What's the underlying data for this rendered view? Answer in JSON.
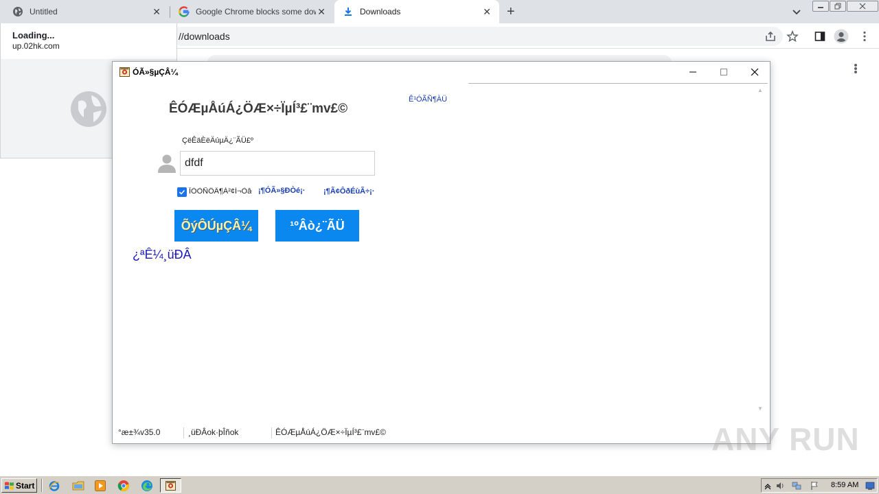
{
  "browser": {
    "tabs": [
      {
        "title": "Untitled",
        "icon": "globe-icon"
      },
      {
        "title": "Google Chrome blocks some downloads",
        "icon": "google-icon"
      },
      {
        "title": "Downloads",
        "icon": "download-icon"
      }
    ],
    "new_tab_label": "+",
    "address": "//downloads"
  },
  "loading_popup": {
    "title": "Loading...",
    "url": "up.02hk.com"
  },
  "app": {
    "window_title": "ÓÃ»§µÇÂ¼",
    "heading": "ÊÓÆµÅúÁ¿ÖÆ×÷ÏµÍ³£¨mv£©",
    "top_link": "Ê¹ÓÃÑ¶ÀÜ",
    "field_label": "ÇëÊäÈëÄúµÄ¿¨ÃÜ£º",
    "username_value": "dfdf",
    "remember_label": "ÎÒÒÑÔÄ¶Á²¢Í¬ÒâÓÃ»§Ð­Òé",
    "link_agreement": "¡¶ÓÃ»§Ð­Òé¡·",
    "link_disclaimer": "¡¶Ã¢ÔðÉùÃ÷¡·",
    "login_button": "ÕýÔÚµÇÂ¼",
    "buy_button": "¹ºÂò¿¨ÃÜ",
    "bottom_link": "¿ªÊ¼¸üÐÂ",
    "status": {
      "version": "°æ±¾v35.0",
      "update": "¸üÐÂok·þÎñok",
      "product": "ÊÓÆµÅúÁ¿ÖÆ×÷ÏµÍ³£¨mv£©"
    }
  },
  "watermark": "ANY RUN",
  "taskbar": {
    "start_label": "Start",
    "clock": "8:59 AM"
  },
  "colors": {
    "tabstrip": "#dee1e6",
    "accent_button": "#0a88f0",
    "link_blue": "#1a3fb0"
  }
}
